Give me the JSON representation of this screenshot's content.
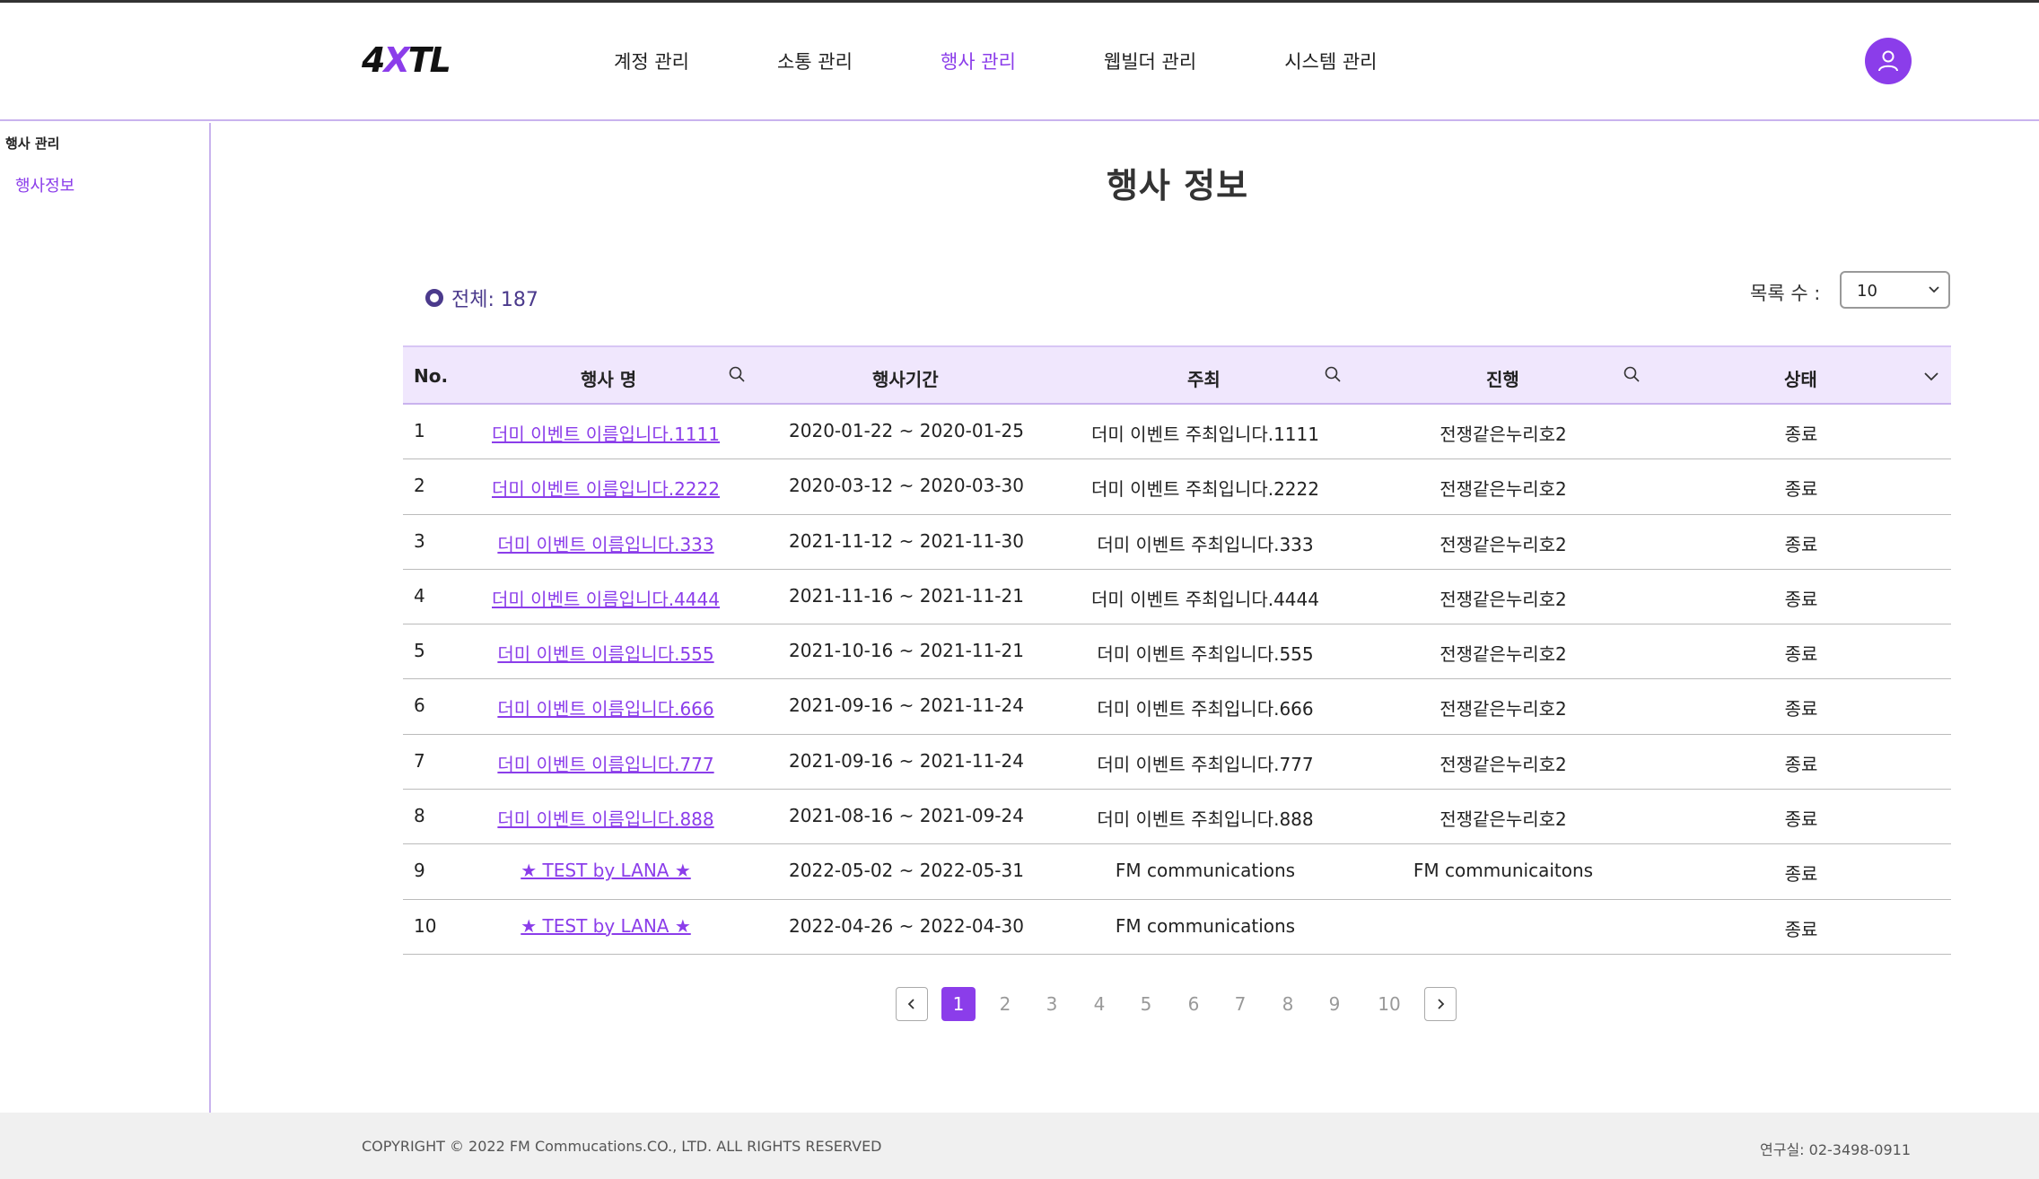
{
  "brand": {
    "logo_left": "4",
    "logo_x": "X",
    "logo_right": "TL",
    "accent_color": "#8b3dea"
  },
  "nav": {
    "items": [
      {
        "label": "계정 관리"
      },
      {
        "label": "소통 관리"
      },
      {
        "label": "행사 관리"
      },
      {
        "label": "웹빌더 관리"
      },
      {
        "label": "시스템 관리"
      }
    ],
    "active_index": 2
  },
  "sidebar": {
    "title": "행사 관리",
    "items": [
      {
        "label": "행사정보"
      }
    ]
  },
  "main": {
    "title": "행사 정보",
    "total_label": "전체: 187",
    "per_page_label": "목록 수 :",
    "per_page_value": "10"
  },
  "table": {
    "headers": {
      "no": "No.",
      "name": "행사 명",
      "period": "행사기간",
      "host": "주최",
      "progress": "진행",
      "status": "상태"
    },
    "rows": [
      {
        "no": "1",
        "name": "더미 이벤트 이름입니다.1111",
        "period": "2020-01-22 ~ 2020-01-25",
        "host": "더미 이벤트 주최입니다.1111",
        "progress": "전쟁같은누리호2",
        "status": "종료"
      },
      {
        "no": "2",
        "name": "더미 이벤트 이름입니다.2222",
        "period": "2020-03-12 ~ 2020-03-30",
        "host": "더미 이벤트 주최입니다.2222",
        "progress": "전쟁같은누리호2",
        "status": "종료"
      },
      {
        "no": "3",
        "name": "더미 이벤트 이름입니다.333",
        "period": "2021-11-12 ~ 2021-11-30",
        "host": "더미 이벤트 주최입니다.333",
        "progress": "전쟁같은누리호2",
        "status": "종료"
      },
      {
        "no": "4",
        "name": "더미 이벤트 이름입니다.4444",
        "period": "2021-11-16 ~ 2021-11-21",
        "host": "더미 이벤트 주최입니다.4444",
        "progress": "전쟁같은누리호2",
        "status": "종료"
      },
      {
        "no": "5",
        "name": "더미 이벤트 이름입니다.555",
        "period": "2021-10-16 ~ 2021-11-21",
        "host": "더미 이벤트 주최입니다.555",
        "progress": "전쟁같은누리호2",
        "status": "종료"
      },
      {
        "no": "6",
        "name": "더미 이벤트 이름입니다.666",
        "period": "2021-09-16 ~ 2021-11-24",
        "host": "더미 이벤트 주최입니다.666",
        "progress": "전쟁같은누리호2",
        "status": "종료"
      },
      {
        "no": "7",
        "name": "더미 이벤트 이름입니다.777",
        "period": "2021-09-16 ~ 2021-11-24",
        "host": "더미 이벤트 주최입니다.777",
        "progress": "전쟁같은누리호2",
        "status": "종료"
      },
      {
        "no": "8",
        "name": "더미 이벤트 이름입니다.888",
        "period": "2021-08-16 ~ 2021-09-24",
        "host": "더미 이벤트 주최입니다.888",
        "progress": "전쟁같은누리호2",
        "status": "종료"
      },
      {
        "no": "9",
        "name": "★ TEST by LANA ★",
        "period": "2022-05-02 ~ 2022-05-31",
        "host": "FM communications",
        "progress": "FM communicaitons",
        "status": "종료"
      },
      {
        "no": "10",
        "name": "★ TEST by LANA ★",
        "period": "2022-04-26 ~ 2022-04-30",
        "host": "FM communications",
        "progress": "",
        "status": "종료"
      }
    ]
  },
  "pagination": {
    "pages": [
      "1",
      "2",
      "3",
      "4",
      "5",
      "6",
      "7",
      "8",
      "9",
      "10"
    ],
    "current": "1"
  },
  "footer": {
    "copyright": "COPYRIGHT © 2022 FM Commucations.CO., LTD. ALL RIGHTS RESERVED",
    "contact": "연구실: 02-3498-0911"
  }
}
